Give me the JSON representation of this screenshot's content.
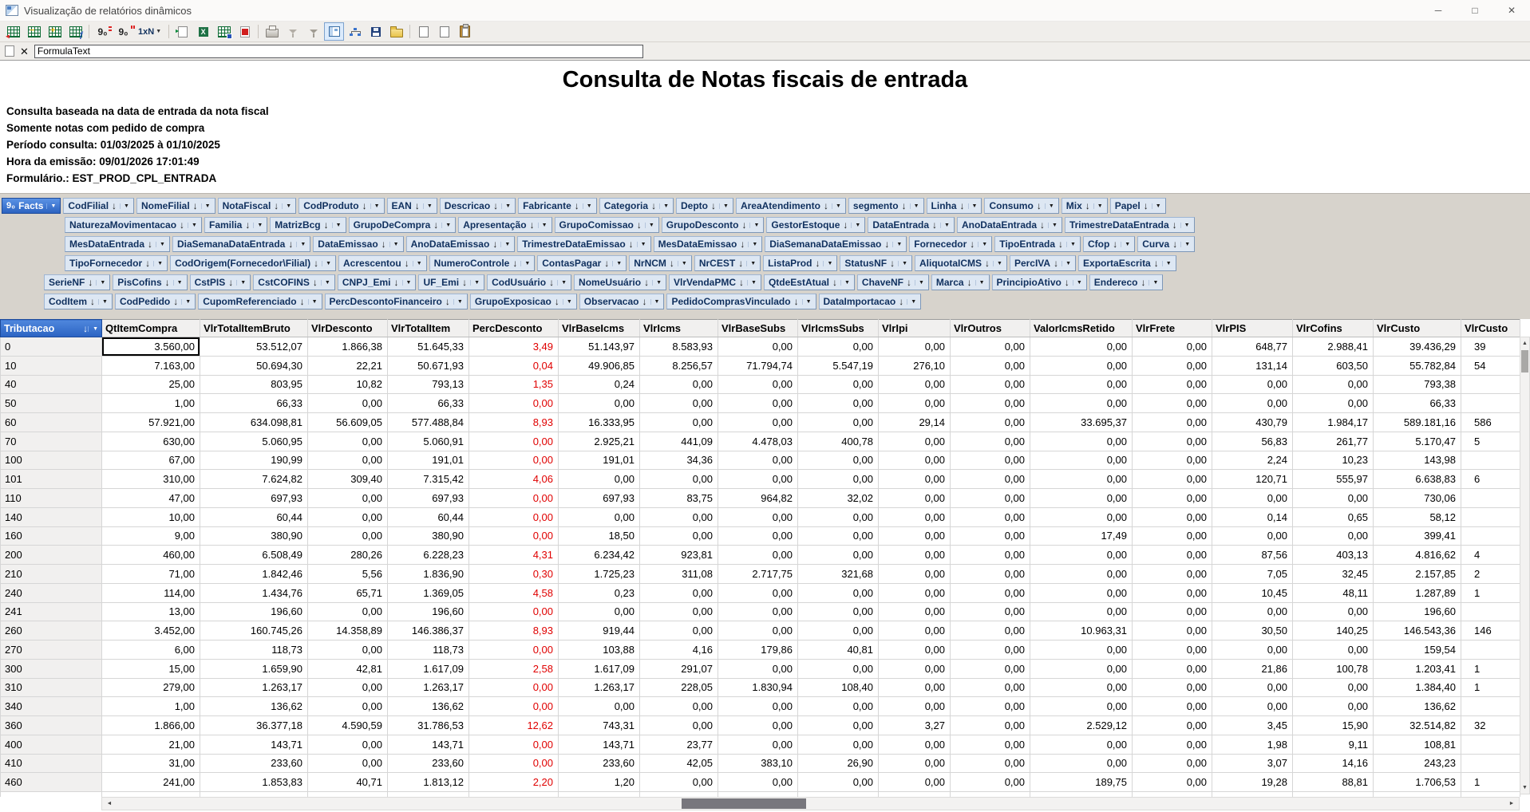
{
  "window": {
    "title": "Visualização de relatórios dinâmicos",
    "controls": {
      "minimize": "─",
      "maximize": "□",
      "close": "✕"
    }
  },
  "toolbar": {
    "groups": [
      [
        {
          "name": "grid-arrow-icon"
        },
        {
          "name": "grid-minus-icon"
        },
        {
          "name": "grid-plus-icon"
        },
        {
          "name": "grid-formula-icon"
        }
      ],
      [
        {
          "name": "decimal-places-icon"
        },
        {
          "name": "thousand-separator-icon"
        },
        {
          "name": "scale-dropdown",
          "label": "1xN"
        }
      ],
      [
        {
          "name": "export-data-icon"
        },
        {
          "name": "export-excel-icon"
        },
        {
          "name": "export-grid-icon"
        },
        {
          "name": "export-pdf-icon"
        }
      ],
      [
        {
          "name": "print-icon"
        },
        {
          "name": "filter-values-icon"
        },
        {
          "name": "filter-clear-icon"
        },
        {
          "name": "toggle-panel-icon",
          "pressed": true
        },
        {
          "name": "hierarchy-icon"
        },
        {
          "name": "save-icon"
        },
        {
          "name": "open-icon"
        }
      ],
      [
        {
          "name": "copy-icon"
        },
        {
          "name": "copy-page-icon"
        },
        {
          "name": "paste-icon"
        }
      ]
    ]
  },
  "formula_bar": {
    "value": "FormulaText"
  },
  "report": {
    "title": "Consulta de Notas fiscais de entrada",
    "info_lines": [
      "Consulta baseada na data de entrada da nota fiscal",
      "Somente notas com pedido de compra",
      "Período consulta: 01/03/2025 à 01/10/2025",
      "Hora da emissão: 09/01/2026 17:01:49",
      "Formulário.: EST_PROD_CPL_ENTRADA"
    ]
  },
  "pivot": {
    "facts_icon": "9₀",
    "facts_label": "Facts",
    "dimension_rows": [
      [
        "CodFilial",
        "NomeFilial",
        "NotaFiscal",
        "CodProduto",
        "EAN",
        "Descricao",
        "Fabricante",
        "Categoria",
        "Depto",
        "AreaAtendimento",
        "segmento",
        "Linha",
        "Consumo",
        "Mix",
        "Papel"
      ],
      [
        "NaturezaMovimentacao",
        "Familia",
        "MatrizBcg",
        "GrupoDeCompra",
        "Apresentação",
        "GrupoComissao",
        "GrupoDesconto",
        "GestorEstoque",
        "DataEntrada",
        "AnoDataEntrada",
        "TrimestreDataEntrada"
      ],
      [
        "MesDataEntrada",
        "DiaSemanaDataEntrada",
        "DataEmissao",
        "AnoDataEmissao",
        "TrimestreDataEmissao",
        "MesDataEmissao",
        "DiaSemanaDataEmissao",
        "Fornecedor",
        "TipoEntrada",
        "Cfop",
        "Curva"
      ],
      [
        "TipoFornecedor",
        "CodOrigem(Fornecedor\\Filial)",
        "Acrescentou",
        "NumeroControle",
        "ContasPagar",
        "NrNCM",
        "NrCEST",
        "ListaProd",
        "StatusNF",
        "AliquotaICMS",
        "PercIVA",
        "ExportaEscrita"
      ],
      [
        "SerieNF",
        "PisCofins",
        "CstPIS",
        "CstCOFINS",
        "CNPJ_Emi",
        "UF_Emi",
        "CodUsuário",
        "NomeUsuário",
        "VlrVendaPMC",
        "QtdeEstAtual",
        "ChaveNF",
        "Marca",
        "PrincipioAtivo",
        "Endereco"
      ],
      [
        "CodItem",
        "CodPedido",
        "CupomReferenciado",
        "PercDescontoFinanceiro",
        "GrupoExposicao",
        "Observacao",
        "PedidoComprasVinculado",
        "DataImportacao"
      ]
    ]
  },
  "grid": {
    "row_dim_header": "Tributacao",
    "columns": [
      "QtItemCompra",
      "VlrTotalItemBruto",
      "VlrDesconto",
      "VlrTotalItem",
      "PercDesconto",
      "VlrBaseIcms",
      "VlrIcms",
      "VlrBaseSubs",
      "VlrIcmsSubs",
      "VlrIpi",
      "VlrOutros",
      "ValorIcmsRetido",
      "VlrFrete",
      "VlrPIS",
      "VlrCofins",
      "VlrCusto",
      "VlrCusto"
    ],
    "rows": [
      {
        "label": "0",
        "values": [
          "3.560,00",
          "53.512,07",
          "1.866,38",
          "51.645,33",
          "3,49",
          "51.143,97",
          "8.583,93",
          "0,00",
          "0,00",
          "0,00",
          "0,00",
          "0,00",
          "0,00",
          "648,77",
          "2.988,41",
          "39.436,29"
        ],
        "clipped": "39"
      },
      {
        "label": "10",
        "values": [
          "7.163,00",
          "50.694,30",
          "22,21",
          "50.671,93",
          "0,04",
          "49.906,85",
          "8.256,57",
          "71.794,74",
          "5.547,19",
          "276,10",
          "0,00",
          "0,00",
          "0,00",
          "131,14",
          "603,50",
          "55.782,84"
        ],
        "clipped": "54"
      },
      {
        "label": "40",
        "values": [
          "25,00",
          "803,95",
          "10,82",
          "793,13",
          "1,35",
          "0,24",
          "0,00",
          "0,00",
          "0,00",
          "0,00",
          "0,00",
          "0,00",
          "0,00",
          "0,00",
          "0,00",
          "793,38"
        ],
        "clipped": ""
      },
      {
        "label": "50",
        "values": [
          "1,00",
          "66,33",
          "0,00",
          "66,33",
          "0,00",
          "0,00",
          "0,00",
          "0,00",
          "0,00",
          "0,00",
          "0,00",
          "0,00",
          "0,00",
          "0,00",
          "0,00",
          "66,33"
        ],
        "clipped": ""
      },
      {
        "label": "60",
        "values": [
          "57.921,00",
          "634.098,81",
          "56.609,05",
          "577.488,84",
          "8,93",
          "16.333,95",
          "0,00",
          "0,00",
          "0,00",
          "29,14",
          "0,00",
          "33.695,37",
          "0,00",
          "430,79",
          "1.984,17",
          "589.181,16"
        ],
        "clipped": "586"
      },
      {
        "label": "70",
        "values": [
          "630,00",
          "5.060,95",
          "0,00",
          "5.060,91",
          "0,00",
          "2.925,21",
          "441,09",
          "4.478,03",
          "400,78",
          "0,00",
          "0,00",
          "0,00",
          "0,00",
          "56,83",
          "261,77",
          "5.170,47"
        ],
        "clipped": "5"
      },
      {
        "label": "100",
        "values": [
          "67,00",
          "190,99",
          "0,00",
          "191,01",
          "0,00",
          "191,01",
          "34,36",
          "0,00",
          "0,00",
          "0,00",
          "0,00",
          "0,00",
          "0,00",
          "2,24",
          "10,23",
          "143,98"
        ],
        "clipped": ""
      },
      {
        "label": "101",
        "values": [
          "310,00",
          "7.624,82",
          "309,40",
          "7.315,42",
          "4,06",
          "0,00",
          "0,00",
          "0,00",
          "0,00",
          "0,00",
          "0,00",
          "0,00",
          "0,00",
          "120,71",
          "555,97",
          "6.638,83"
        ],
        "clipped": "6"
      },
      {
        "label": "110",
        "values": [
          "47,00",
          "697,93",
          "0,00",
          "697,93",
          "0,00",
          "697,93",
          "83,75",
          "964,82",
          "32,02",
          "0,00",
          "0,00",
          "0,00",
          "0,00",
          "0,00",
          "0,00",
          "730,06"
        ],
        "clipped": ""
      },
      {
        "label": "140",
        "values": [
          "10,00",
          "60,44",
          "0,00",
          "60,44",
          "0,00",
          "0,00",
          "0,00",
          "0,00",
          "0,00",
          "0,00",
          "0,00",
          "0,00",
          "0,00",
          "0,14",
          "0,65",
          "58,12"
        ],
        "clipped": ""
      },
      {
        "label": "160",
        "values": [
          "9,00",
          "380,90",
          "0,00",
          "380,90",
          "0,00",
          "18,50",
          "0,00",
          "0,00",
          "0,00",
          "0,00",
          "0,00",
          "17,49",
          "0,00",
          "0,00",
          "0,00",
          "399,41"
        ],
        "clipped": ""
      },
      {
        "label": "200",
        "values": [
          "460,00",
          "6.508,49",
          "280,26",
          "6.228,23",
          "4,31",
          "6.234,42",
          "923,81",
          "0,00",
          "0,00",
          "0,00",
          "0,00",
          "0,00",
          "0,00",
          "87,56",
          "403,13",
          "4.816,62"
        ],
        "clipped": "4"
      },
      {
        "label": "210",
        "values": [
          "71,00",
          "1.842,46",
          "5,56",
          "1.836,90",
          "0,30",
          "1.725,23",
          "311,08",
          "2.717,75",
          "321,68",
          "0,00",
          "0,00",
          "0,00",
          "0,00",
          "7,05",
          "32,45",
          "2.157,85"
        ],
        "clipped": "2"
      },
      {
        "label": "240",
        "values": [
          "114,00",
          "1.434,76",
          "65,71",
          "1.369,05",
          "4,58",
          "0,23",
          "0,00",
          "0,00",
          "0,00",
          "0,00",
          "0,00",
          "0,00",
          "0,00",
          "10,45",
          "48,11",
          "1.287,89"
        ],
        "clipped": "1"
      },
      {
        "label": "241",
        "values": [
          "13,00",
          "196,60",
          "0,00",
          "196,60",
          "0,00",
          "0,00",
          "0,00",
          "0,00",
          "0,00",
          "0,00",
          "0,00",
          "0,00",
          "0,00",
          "0,00",
          "0,00",
          "196,60"
        ],
        "clipped": ""
      },
      {
        "label": "260",
        "values": [
          "3.452,00",
          "160.745,26",
          "14.358,89",
          "146.386,37",
          "8,93",
          "919,44",
          "0,00",
          "0,00",
          "0,00",
          "0,00",
          "0,00",
          "10.963,31",
          "0,00",
          "30,50",
          "140,25",
          "146.543,36"
        ],
        "clipped": "146"
      },
      {
        "label": "270",
        "values": [
          "6,00",
          "118,73",
          "0,00",
          "118,73",
          "0,00",
          "103,88",
          "4,16",
          "179,86",
          "40,81",
          "0,00",
          "0,00",
          "0,00",
          "0,00",
          "0,00",
          "0,00",
          "159,54"
        ],
        "clipped": ""
      },
      {
        "label": "300",
        "values": [
          "15,00",
          "1.659,90",
          "42,81",
          "1.617,09",
          "2,58",
          "1.617,09",
          "291,07",
          "0,00",
          "0,00",
          "0,00",
          "0,00",
          "0,00",
          "0,00",
          "21,86",
          "100,78",
          "1.203,41"
        ],
        "clipped": "1"
      },
      {
        "label": "310",
        "values": [
          "279,00",
          "1.263,17",
          "0,00",
          "1.263,17",
          "0,00",
          "1.263,17",
          "228,05",
          "1.830,94",
          "108,40",
          "0,00",
          "0,00",
          "0,00",
          "0,00",
          "0,00",
          "0,00",
          "1.384,40"
        ],
        "clipped": "1"
      },
      {
        "label": "340",
        "values": [
          "1,00",
          "136,62",
          "0,00",
          "136,62",
          "0,00",
          "0,00",
          "0,00",
          "0,00",
          "0,00",
          "0,00",
          "0,00",
          "0,00",
          "0,00",
          "0,00",
          "0,00",
          "136,62"
        ],
        "clipped": ""
      },
      {
        "label": "360",
        "values": [
          "1.866,00",
          "36.377,18",
          "4.590,59",
          "31.786,53",
          "12,62",
          "743,31",
          "0,00",
          "0,00",
          "0,00",
          "3,27",
          "0,00",
          "2.529,12",
          "0,00",
          "3,45",
          "15,90",
          "32.514,82"
        ],
        "clipped": "32"
      },
      {
        "label": "400",
        "values": [
          "21,00",
          "143,71",
          "0,00",
          "143,71",
          "0,00",
          "143,71",
          "23,77",
          "0,00",
          "0,00",
          "0,00",
          "0,00",
          "0,00",
          "0,00",
          "1,98",
          "9,11",
          "108,81"
        ],
        "clipped": ""
      },
      {
        "label": "410",
        "values": [
          "31,00",
          "233,60",
          "0,00",
          "233,60",
          "0,00",
          "233,60",
          "42,05",
          "383,10",
          "26,90",
          "0,00",
          "0,00",
          "0,00",
          "0,00",
          "3,07",
          "14,16",
          "243,23"
        ],
        "clipped": ""
      },
      {
        "label": "460",
        "values": [
          "241,00",
          "1.853,83",
          "40,71",
          "1.813,12",
          "2,20",
          "1,20",
          "0,00",
          "0,00",
          "0,00",
          "0,00",
          "0,00",
          "189,75",
          "0,00",
          "19,28",
          "88,81",
          "1.706,53"
        ],
        "clipped": "1"
      }
    ]
  },
  "colors": {
    "accent_blue": "#2f6bc6",
    "dim_button_bg": "#dde7f3",
    "dim_button_text": "#10305e",
    "panel_bg": "#d7d3cc",
    "negative_red": "#e00000",
    "header_bg": "#f1f0ef",
    "grid_line": "#d6d6d6"
  }
}
